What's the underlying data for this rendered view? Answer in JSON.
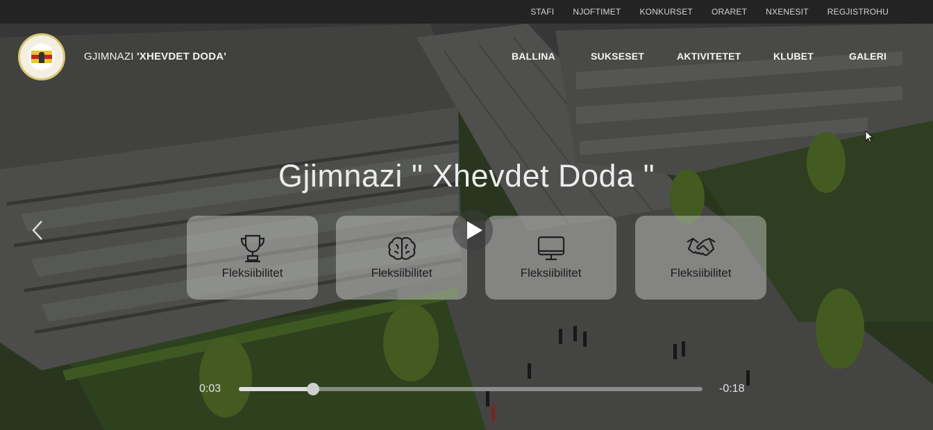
{
  "topbar": {
    "links": [
      "STAFI",
      "NJOFTIMET",
      "KONKURSET",
      "ORARET",
      "NXENESIT",
      "REGJISTROHU"
    ]
  },
  "brand": {
    "prefix": "GJIMNAZI ",
    "name": "'XHEVDET DODA'"
  },
  "nav": {
    "items": [
      "BALLINA",
      "SUKSESET",
      "AKTIVITETET",
      "KLUBET",
      "GALERI"
    ]
  },
  "hero": {
    "title": "Gjimnazi \" Xhevdet Doda \""
  },
  "cards": [
    {
      "label": "Fleksiibilitet",
      "icon": "trophy-icon"
    },
    {
      "label": "Fleksiibilitet",
      "icon": "brain-icon"
    },
    {
      "label": "Fleksiibilitet",
      "icon": "monitor-icon"
    },
    {
      "label": "Fleksiibilitet",
      "icon": "handshake-icon"
    }
  ],
  "player": {
    "current_time": "0:03",
    "remaining_time": "-0:18",
    "progress": 0.16
  },
  "colors": {
    "topbar_bg": "#232323",
    "text_light": "#f5f5f5",
    "card_bg": "rgba(210,210,210,0.45)",
    "logo_red": "#c8202a",
    "logo_yellow": "#e8c830"
  }
}
